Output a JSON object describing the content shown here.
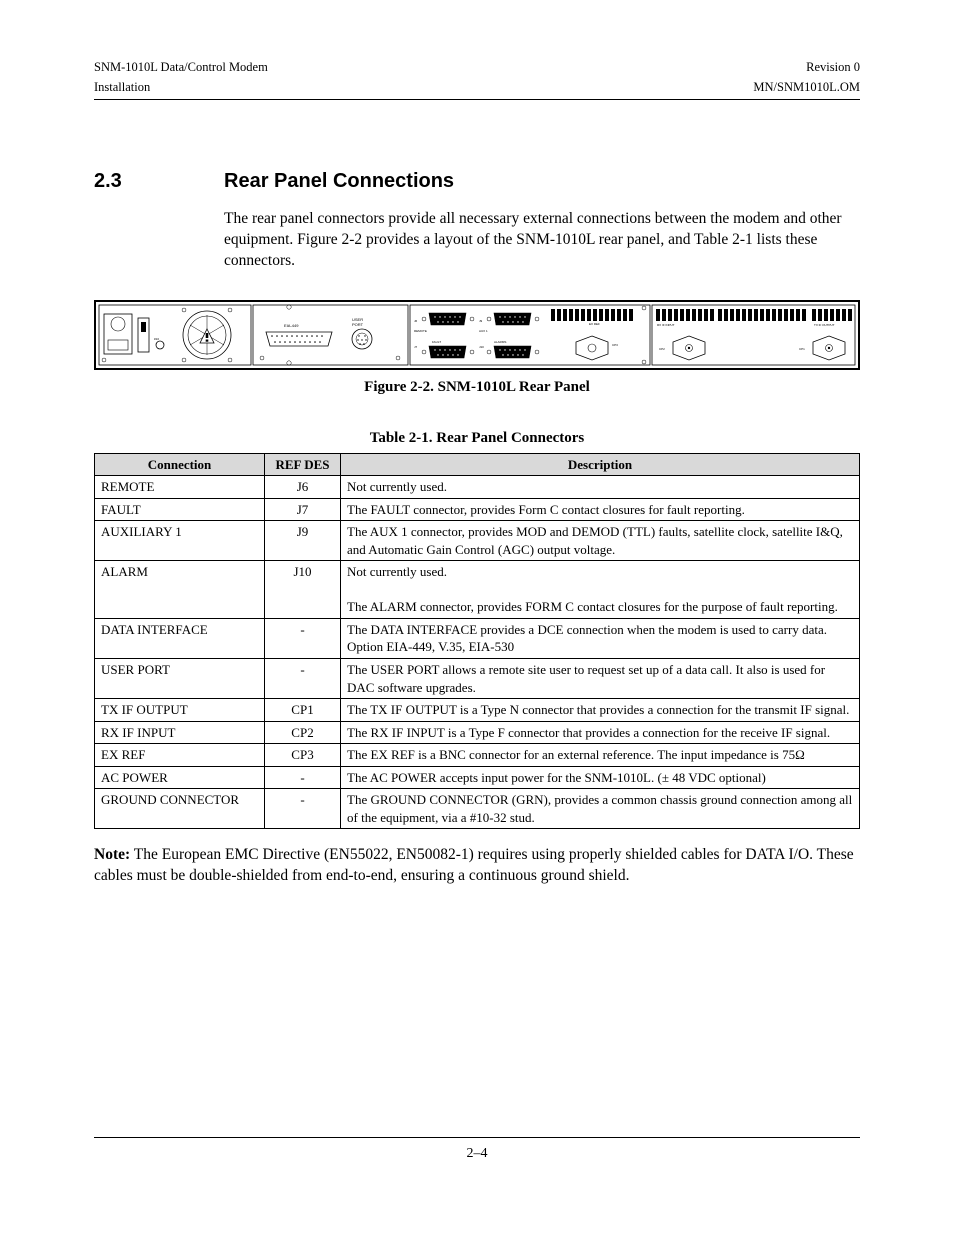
{
  "header": {
    "left_line1": "SNM-1010L Data/Control Modem",
    "left_line2": "Installation",
    "right_line1": "Revision 0",
    "right_line2": "MN/SNM1010L.OM"
  },
  "section": {
    "number": "2.3",
    "title": "Rear Panel Connections",
    "paragraph": "The rear panel connectors provide all necessary external connections between the modem and other equipment. Figure 2-2 provides a layout of the SNM-1010L rear panel, and Table 2-1 lists these connectors."
  },
  "figure": {
    "caption": "Figure 2-2.  SNM-1010L Rear Panel",
    "labels": {
      "eia449": "EIA-449",
      "user_port_l1": "USER",
      "user_port_l2": "PORT",
      "j6": "J6",
      "remote": "REMOTE",
      "j9": "J9",
      "aux1": "AUX 1",
      "j7": "J7",
      "fault": "FAULT",
      "j10": "J10",
      "alarms": "ALARMS",
      "exref": "EX REF",
      "cp3": "CP3",
      "rxif": "RX IF INPUT",
      "cp2": "CP2",
      "txif": "TX IF OUTPUT",
      "cp1": "CP1",
      "gnd": "#10"
    }
  },
  "table": {
    "caption": "Table 2-1.  Rear Panel Connectors",
    "headers": {
      "connection": "Connection",
      "refdes": "REF DES",
      "description": "Description"
    },
    "rows": [
      {
        "connection": "REMOTE",
        "refdes": "J6",
        "description": "Not currently used."
      },
      {
        "connection": "FAULT",
        "refdes": "J7",
        "description": "The FAULT connector, provides Form C contact closures for fault reporting."
      },
      {
        "connection": "AUXILIARY 1",
        "refdes": "J9",
        "description": "The AUX 1 connector, provides MOD and  DEMOD (TTL) faults, satellite clock, satellite I&Q, and Automatic Gain Control (AGC) output voltage."
      },
      {
        "connection": "ALARM",
        "refdes": "J10",
        "description": "Not currently used.\n\nThe ALARM  connector, provides FORM C contact closures for the purpose of fault reporting."
      },
      {
        "connection": "DATA INTERFACE",
        "refdes": "-",
        "description": "The DATA INTERFACE provides a DCE connection when the modem is used to carry data. Option EIA-449, V.35, EIA-530"
      },
      {
        "connection": "USER PORT",
        "refdes": "-",
        "description": "The USER PORT allows a remote site user to request set up of a data call. It also is used for DAC software upgrades."
      },
      {
        "connection": "TX IF OUTPUT",
        "refdes": "CP1",
        "description": "The TX IF OUTPUT is a Type N connector that provides a connection for the transmit IF signal."
      },
      {
        "connection": "RX IF INPUT",
        "refdes": "CP2",
        "description": "The RX IF INPUT is a Type F connector that provides a connection for the receive IF signal."
      },
      {
        "connection": "EX REF",
        "refdes": "CP3",
        "description": "The EX REF is a BNC connector for an external reference. The input impedance is 75Ω"
      },
      {
        "connection": "AC POWER",
        "refdes": "-",
        "description": "The AC POWER  accepts input power for the SNM-1010L. (± 48 VDC optional)"
      },
      {
        "connection": "GROUND CONNECTOR",
        "refdes": "-",
        "description": "The GROUND CONNECTOR (GRN), provides a common chassis ground connection among all of the equipment, via a #10-32 stud."
      }
    ]
  },
  "note": {
    "label": "Note:",
    "text": " The European EMC Directive (EN55022, EN50082-1) requires using properly shielded cables for DATA I/O. These cables must be double-shielded from end-to-end, ensuring a continuous ground shield."
  },
  "footer": {
    "page": "2–4"
  }
}
